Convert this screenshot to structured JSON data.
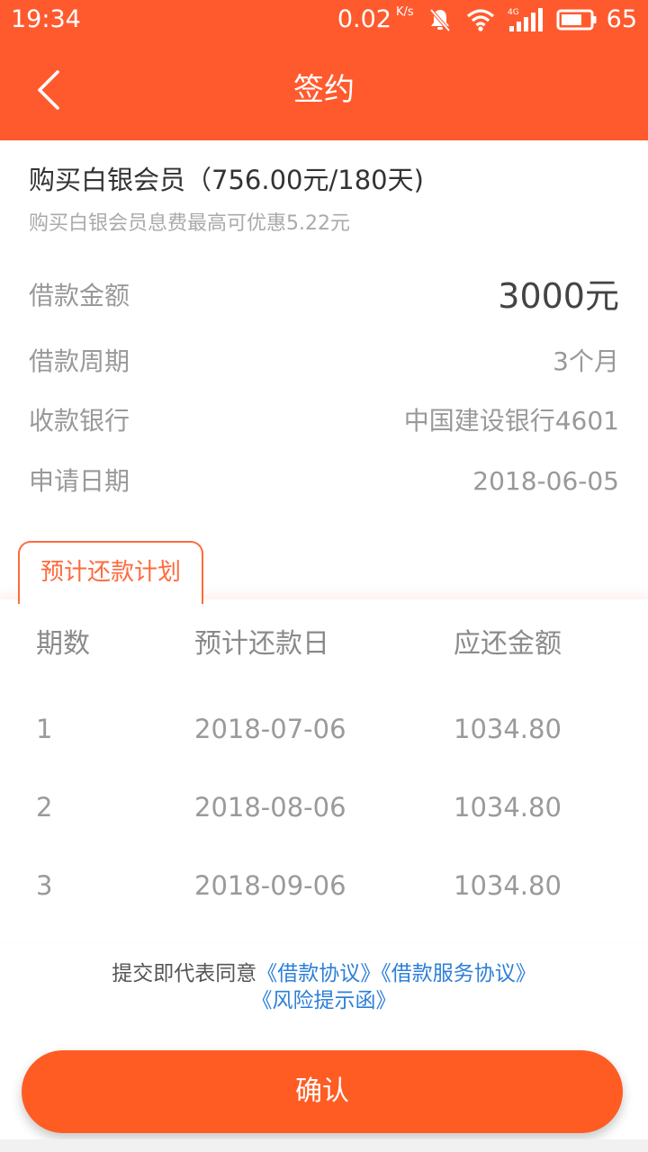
{
  "status_bar": {
    "time": "19:34",
    "net_speed": "0.02",
    "net_speed_unit": "K/s",
    "network_type": "4G",
    "battery": "65",
    "icons": [
      "mute-bell-icon",
      "wifi-icon",
      "signal-4g-icon",
      "battery-icon"
    ]
  },
  "header": {
    "title": "签约",
    "back_icon": "chevron-left-icon"
  },
  "membership": {
    "title": "购买白银会员（756.00元/180天)",
    "subtitle": "购买白银会员息费最高可优惠5.22元"
  },
  "loan_info": [
    {
      "label": "借款金额",
      "value": "3000元"
    },
    {
      "label": "借款周期",
      "value": "3个月"
    },
    {
      "label": "收款银行",
      "value": "中国建设银行4601"
    },
    {
      "label": "申请日期",
      "value": "2018-06-05"
    }
  ],
  "plan": {
    "tab_label": "预计还款计划",
    "columns": [
      "期数",
      "预计还款日",
      "应还金额"
    ],
    "rows": [
      [
        "1",
        "2018-07-06",
        "1034.80"
      ],
      [
        "2",
        "2018-08-06",
        "1034.80"
      ],
      [
        "3",
        "2018-09-06",
        "1034.80"
      ]
    ]
  },
  "agreement": {
    "prefix": "提交即代表同意",
    "link1": "《借款协议》",
    "link2": "《借款服务协议》",
    "link3": "《风险提示函》"
  },
  "confirm_label": "确认",
  "colors": {
    "brand": "#ff5a2e",
    "button": "#ff5c24",
    "link": "#2d7fd8",
    "tab": "#ff6a3d"
  }
}
